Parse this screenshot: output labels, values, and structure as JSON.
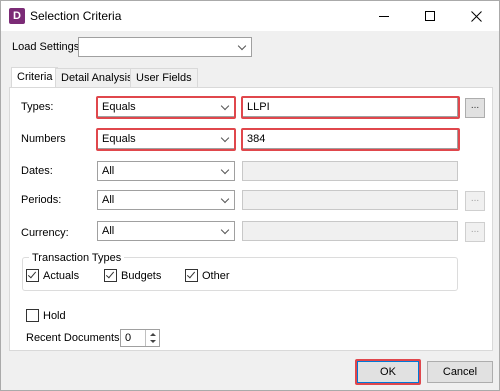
{
  "window": {
    "app_icon": "D",
    "title": "Selection Criteria",
    "icons": {
      "minimize": "minimize-icon",
      "maximize": "maximize-icon",
      "close": "close-icon"
    }
  },
  "load_settings": {
    "label": "Load Settings:",
    "value": ""
  },
  "tabs": [
    {
      "label": "Criteria",
      "active": true
    },
    {
      "label": "Detail Analysis",
      "active": false
    },
    {
      "label": "User Fields",
      "active": false
    }
  ],
  "criteria": {
    "types": {
      "label": "Types:",
      "operator": "Equals",
      "value": "LLPI",
      "button": "..."
    },
    "numbers": {
      "label": "Numbers",
      "operator": "Equals",
      "value": "384"
    },
    "dates": {
      "label": "Dates:",
      "operator": "All",
      "value": ""
    },
    "periods": {
      "label": "Periods:",
      "operator": "All",
      "value": "",
      "button": "..."
    },
    "currency": {
      "label": "Currency:",
      "operator": "All",
      "value": "",
      "button": "..."
    }
  },
  "transaction_types": {
    "title": "Transaction Types",
    "actuals": {
      "label": "Actuals",
      "checked": true
    },
    "budgets": {
      "label": "Budgets",
      "checked": true
    },
    "other": {
      "label": "Other",
      "checked": true
    }
  },
  "hold": {
    "label": "Hold",
    "checked": false
  },
  "recent_documents": {
    "label": "Recent Documents:",
    "value": "0"
  },
  "buttons": {
    "ok": "OK",
    "cancel": "Cancel"
  },
  "colors": {
    "highlight": "#e0474c",
    "app_icon": "#7b2b76",
    "default_button": "#0078d7"
  }
}
